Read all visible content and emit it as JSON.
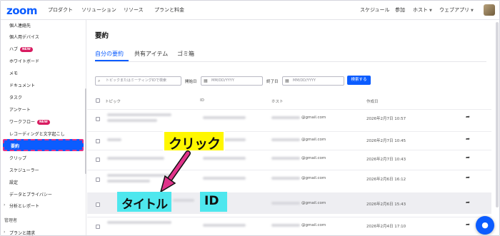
{
  "topnav": {
    "logo": "zoom",
    "left_items": [
      "プロダクト",
      "ソリューション",
      "リソース",
      "プランと料金"
    ],
    "right_items": [
      "スケジュール",
      "参加",
      "ホスト",
      "ウェブアプリ"
    ]
  },
  "sidebar": {
    "items": [
      {
        "label": "個人連絡先"
      },
      {
        "label": "個人用デバイス"
      },
      {
        "label": "ハブ",
        "badge": "NEW"
      },
      {
        "label": "ホワイトボード"
      },
      {
        "label": "メモ"
      },
      {
        "label": "ドキュメント"
      },
      {
        "label": "タスク"
      },
      {
        "label": "アンケート"
      },
      {
        "label": "ワークフロー",
        "badge": "NEW"
      },
      {
        "label": "レコーディングと文字起こし"
      },
      {
        "label": "要約",
        "active": true
      },
      {
        "label": "クリップ"
      },
      {
        "label": "スケジューラー"
      },
      {
        "label": "設定"
      },
      {
        "label": "データとプライバシー"
      },
      {
        "label": "分析とレポート"
      },
      {
        "label": "管理者"
      },
      {
        "label": "プランと請求"
      }
    ]
  },
  "main": {
    "title": "要約",
    "tabs": [
      "自分の要約",
      "共有アイテム",
      "ゴミ箱"
    ],
    "filters": {
      "search_placeholder": "トピックまたはミーティングIDで検索",
      "start_label": "開始日",
      "start_placeholder": "MM/DD/YYYY",
      "end_label": "終了日",
      "end_placeholder": "MM/DD/YYYY",
      "search_button": "検索する"
    },
    "columns": [
      "トピック",
      "ID",
      "ホスト",
      "作成日"
    ],
    "rows": [
      {
        "email_suffix": "@gmail.com",
        "date": "2026年2月7日 10:57"
      },
      {
        "email_suffix": "@gmail.com",
        "date": "2026年2月7日 10:45"
      },
      {
        "email_suffix": "@gmail.com",
        "date": "2026年2月7日 10:43"
      },
      {
        "email_suffix": "@gmail.com",
        "date": "2026年2月6日 16:12"
      },
      {
        "email_suffix": "@gmail.com",
        "date": "2026年2月6日 15:43"
      },
      {
        "email_suffix": "@gmail.com",
        "date": "2026年2月4日 17:10"
      }
    ]
  },
  "annotations": {
    "click": "クリック",
    "title": "タイトル",
    "id": "ID"
  },
  "colors": {
    "accent": "#0b5cff",
    "callout_yellow": "#fff700",
    "callout_cyan": "#4ee7ee",
    "highlight_border": "#e0338a",
    "badge": "#d81b60"
  }
}
